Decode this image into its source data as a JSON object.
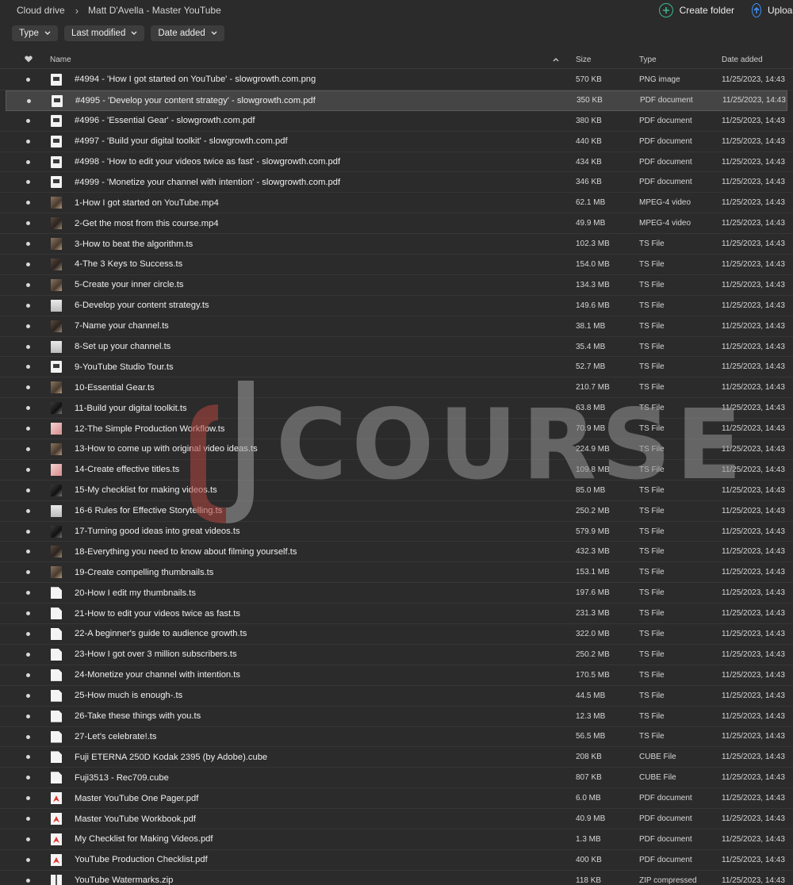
{
  "breadcrumb": {
    "root": "Cloud drive",
    "current": "Matt D'Avella - Master YouTube"
  },
  "actions": {
    "create_folder": "Create folder",
    "upload": "Upload"
  },
  "filters": [
    "Type",
    "Last modified",
    "Date added"
  ],
  "columns": {
    "name": "Name",
    "size": "Size",
    "type": "Type",
    "date": "Date added"
  },
  "watermark": {
    "text": "COURSE"
  },
  "colors": {
    "background": "#2b2b2b",
    "create_folder_icon": "#3fb68b",
    "upload_icon": "#3f8ef0",
    "watermark_accent": "#b3463f"
  },
  "files": [
    {
      "name": "#4994 - 'How I got started on YouTube' - slowgrowth.com.png",
      "size": "570 KB",
      "type": "PNG image",
      "date": "11/25/2023, 14:43",
      "icon": "doc"
    },
    {
      "name": "#4995 - 'Develop your content strategy' - slowgrowth.com.pdf",
      "size": "350 KB",
      "type": "PDF document",
      "date": "11/25/2023, 14:43",
      "icon": "doc"
    },
    {
      "name": "#4996 - 'Essential Gear' - slowgrowth.com.pdf",
      "size": "380 KB",
      "type": "PDF document",
      "date": "11/25/2023, 14:43",
      "icon": "doc"
    },
    {
      "name": "#4997 - 'Build your digital toolkit' - slowgrowth.com.pdf",
      "size": "440 KB",
      "type": "PDF document",
      "date": "11/25/2023, 14:43",
      "icon": "doc"
    },
    {
      "name": "#4998 - 'How to edit your videos twice as fast' - slowgrowth.com.pdf",
      "size": "434 KB",
      "type": "PDF document",
      "date": "11/25/2023, 14:43",
      "icon": "doc"
    },
    {
      "name": "#4999 - 'Monetize your channel with intention' - slowgrowth.com.pdf",
      "size": "346 KB",
      "type": "PDF document",
      "date": "11/25/2023, 14:43",
      "icon": "doc"
    },
    {
      "name": "1-How I got started on YouTube.mp4",
      "size": "62.1 MB",
      "type": "MPEG-4 video",
      "date": "11/25/2023, 14:43",
      "icon": "vid"
    },
    {
      "name": "2-Get the most from this course.mp4",
      "size": "49.9 MB",
      "type": "MPEG-4 video",
      "date": "11/25/2023, 14:43",
      "icon": "vid2"
    },
    {
      "name": "3-How to beat the algorithm.ts",
      "size": "102.3 MB",
      "type": "TS File",
      "date": "11/25/2023, 14:43",
      "icon": "vid"
    },
    {
      "name": "4-The 3 Keys to Success.ts",
      "size": "154.0 MB",
      "type": "TS File",
      "date": "11/25/2023, 14:43",
      "icon": "vid2"
    },
    {
      "name": "5-Create your inner circle.ts",
      "size": "134.3 MB",
      "type": "TS File",
      "date": "11/25/2023, 14:43",
      "icon": "vid"
    },
    {
      "name": "6-Develop your content strategy.ts",
      "size": "149.6 MB",
      "type": "TS File",
      "date": "11/25/2023, 14:43",
      "icon": "light"
    },
    {
      "name": "7-Name your channel.ts",
      "size": "38.1 MB",
      "type": "TS File",
      "date": "11/25/2023, 14:43",
      "icon": "vid2"
    },
    {
      "name": "8-Set up your channel.ts",
      "size": "35.4 MB",
      "type": "TS File",
      "date": "11/25/2023, 14:43",
      "icon": "light"
    },
    {
      "name": "9-YouTube Studio Tour.ts",
      "size": "52.7 MB",
      "type": "TS File",
      "date": "11/25/2023, 14:43",
      "icon": "doc"
    },
    {
      "name": "10-Essential Gear.ts",
      "size": "210.7 MB",
      "type": "TS File",
      "date": "11/25/2023, 14:43",
      "icon": "vid"
    },
    {
      "name": "11-Build your digital toolkit.ts",
      "size": "63.8 MB",
      "type": "TS File",
      "date": "11/25/2023, 14:43",
      "icon": "dark"
    },
    {
      "name": "12-The Simple Production Workflow.ts",
      "size": "70.9 MB",
      "type": "TS File",
      "date": "11/25/2023, 14:43",
      "icon": "red"
    },
    {
      "name": "13-How to come up with original video ideas.ts",
      "size": "224.9 MB",
      "type": "TS File",
      "date": "11/25/2023, 14:43",
      "icon": "vid"
    },
    {
      "name": "14-Create effective titles.ts",
      "size": "109.8 MB",
      "type": "TS File",
      "date": "11/25/2023, 14:43",
      "icon": "red"
    },
    {
      "name": "15-My checklist for making videos.ts",
      "size": "85.0 MB",
      "type": "TS File",
      "date": "11/25/2023, 14:43",
      "icon": "dark"
    },
    {
      "name": "16-6 Rules for Effective Storytelling.ts",
      "size": "250.2 MB",
      "type": "TS File",
      "date": "11/25/2023, 14:43",
      "icon": "light"
    },
    {
      "name": "17-Turning good ideas into great videos.ts",
      "size": "579.9 MB",
      "type": "TS File",
      "date": "11/25/2023, 14:43",
      "icon": "dark"
    },
    {
      "name": "18-Everything you need to know about filming yourself.ts",
      "size": "432.3 MB",
      "type": "TS File",
      "date": "11/25/2023, 14:43",
      "icon": "vid2"
    },
    {
      "name": "19-Create compelling thumbnails.ts",
      "size": "153.1 MB",
      "type": "TS File",
      "date": "11/25/2023, 14:43",
      "icon": "vid"
    },
    {
      "name": "20-How I edit my thumbnails.ts",
      "size": "197.6 MB",
      "type": "TS File",
      "date": "11/25/2023, 14:43",
      "icon": "blank"
    },
    {
      "name": "21-How to edit your videos twice as fast.ts",
      "size": "231.3 MB",
      "type": "TS File",
      "date": "11/25/2023, 14:43",
      "icon": "blank"
    },
    {
      "name": "22-A beginner's guide to audience growth.ts",
      "size": "322.0 MB",
      "type": "TS File",
      "date": "11/25/2023, 14:43",
      "icon": "blank"
    },
    {
      "name": "23-How I got over 3 million subscribers.ts",
      "size": "250.2 MB",
      "type": "TS File",
      "date": "11/25/2023, 14:43",
      "icon": "blank"
    },
    {
      "name": "24-Monetize your channel with intention.ts",
      "size": "170.5 MB",
      "type": "TS File",
      "date": "11/25/2023, 14:43",
      "icon": "blank"
    },
    {
      "name": "25-How much is enough-.ts",
      "size": "44.5 MB",
      "type": "TS File",
      "date": "11/25/2023, 14:43",
      "icon": "blank"
    },
    {
      "name": "26-Take these things with you.ts",
      "size": "12.3 MB",
      "type": "TS File",
      "date": "11/25/2023, 14:43",
      "icon": "blank"
    },
    {
      "name": "27-Let's celebrate!.ts",
      "size": "56.5 MB",
      "type": "TS File",
      "date": "11/25/2023, 14:43",
      "icon": "blank"
    },
    {
      "name": "Fuji ETERNA 250D Kodak 2395 (by Adobe).cube",
      "size": "208 KB",
      "type": "CUBE File",
      "date": "11/25/2023, 14:43",
      "icon": "blank"
    },
    {
      "name": "Fuji3513 - Rec709.cube",
      "size": "807 KB",
      "type": "CUBE File",
      "date": "11/25/2023, 14:43",
      "icon": "blank"
    },
    {
      "name": "Master YouTube One Pager.pdf",
      "size": "6.0 MB",
      "type": "PDF document",
      "date": "11/25/2023, 14:43",
      "icon": "pdf"
    },
    {
      "name": "Master YouTube Workbook.pdf",
      "size": "40.9 MB",
      "type": "PDF document",
      "date": "11/25/2023, 14:43",
      "icon": "pdf"
    },
    {
      "name": "My Checklist for Making Videos.pdf",
      "size": "1.3 MB",
      "type": "PDF document",
      "date": "11/25/2023, 14:43",
      "icon": "pdf"
    },
    {
      "name": "YouTube Production Checklist.pdf",
      "size": "400 KB",
      "type": "PDF document",
      "date": "11/25/2023, 14:43",
      "icon": "pdf"
    },
    {
      "name": "YouTube Watermarks.zip",
      "size": "118 KB",
      "type": "ZIP compressed",
      "date": "11/25/2023, 14:43",
      "icon": "zip"
    }
  ],
  "selected_row": 1
}
